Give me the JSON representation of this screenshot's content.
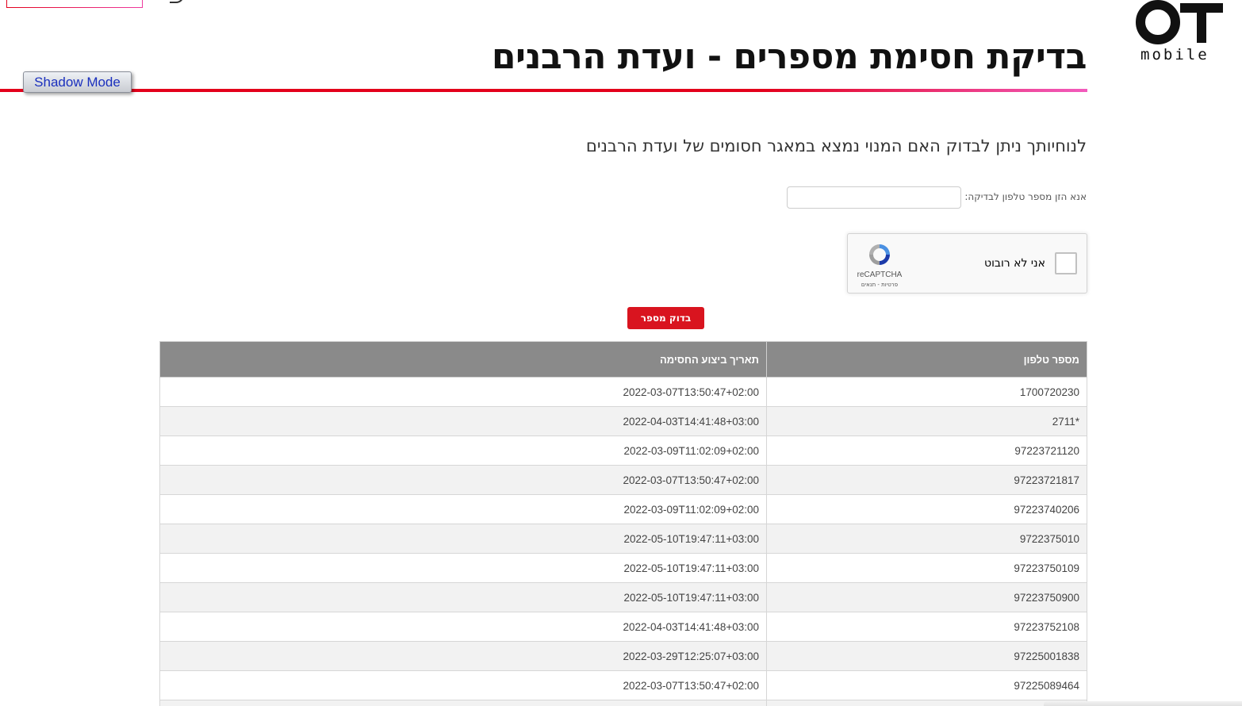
{
  "brand": {
    "logo_letters": "OT",
    "logo_word": "mobile"
  },
  "header": {
    "title": "בדיקת חסימת מספרים - ועדת הרבנים",
    "shadow_mode_label": "Shadow Mode"
  },
  "main": {
    "subtitle": "לנוחיותך ניתן לבדוק האם המנוי נמצא במאגר חסומים של ועדת הרבנים",
    "phone_label": "אנא הזן מספר טלפון לבדיקה:",
    "phone_value": "",
    "captcha": {
      "label": "אני לא רובוט",
      "brand": "reCAPTCHA",
      "terms": "פרטיות - תנאים"
    },
    "check_button_label": "בדוק מספר"
  },
  "table": {
    "headers": {
      "phone": "מספר טלפון",
      "date": "תאריך ביצוע החסימה"
    },
    "rows": [
      {
        "phone": "1700720230",
        "date": "2022-03-07T13:50:47+02:00"
      },
      {
        "phone": "*2711",
        "date": "2022-04-03T14:41:48+03:00"
      },
      {
        "phone": "97223721120",
        "date": "2022-03-09T11:02:09+02:00"
      },
      {
        "phone": "97223721817",
        "date": "2022-03-07T13:50:47+02:00"
      },
      {
        "phone": "97223740206",
        "date": "2022-03-09T11:02:09+02:00"
      },
      {
        "phone": "9722375010",
        "date": "2022-05-10T19:47:11+03:00"
      },
      {
        "phone": "97223750109",
        "date": "2022-05-10T19:47:11+03:00"
      },
      {
        "phone": "97223750900",
        "date": "2022-05-10T19:47:11+03:00"
      },
      {
        "phone": "97223752108",
        "date": "2022-04-03T14:41:48+03:00"
      },
      {
        "phone": "97225001838",
        "date": "2022-03-29T12:25:07+03:00"
      },
      {
        "phone": "97225089464",
        "date": "2022-03-07T13:50:47+02:00"
      }
    ]
  },
  "colors": {
    "accent_red": "#e3001b",
    "accent_pink": "#f25bbd",
    "table_header": "#8a8a8a",
    "button_red": "#d9141f"
  }
}
